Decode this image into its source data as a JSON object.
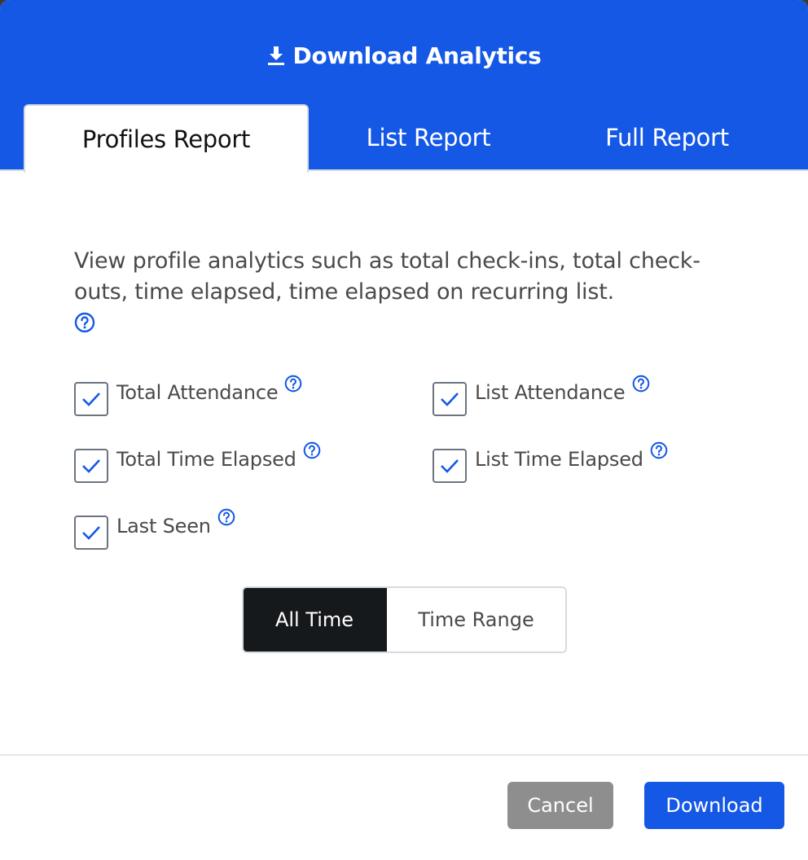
{
  "header": {
    "title": "Download Analytics",
    "title_icon": "download-icon",
    "bg_color": "#1558e6"
  },
  "tabs": [
    {
      "label": "Profiles Report",
      "active": true
    },
    {
      "label": "List Report",
      "active": false
    },
    {
      "label": "Full Report",
      "active": false
    }
  ],
  "description": "View profile analytics such as total check-ins, total check-outs, time elapsed, time elapsed on recurring list.",
  "options": [
    {
      "label": "Total Attendance",
      "checked": true
    },
    {
      "label": "List Attendance",
      "checked": true
    },
    {
      "label": "Total Time Elapsed",
      "checked": true
    },
    {
      "label": "List Time Elapsed",
      "checked": true
    },
    {
      "label": "Last Seen",
      "checked": true
    }
  ],
  "time_toggle": {
    "options": [
      "All Time",
      "Time Range"
    ],
    "selected": "All Time"
  },
  "footer": {
    "cancel_label": "Cancel",
    "download_label": "Download"
  },
  "colors": {
    "accent": "#1558e6",
    "cancel": "#8e8e8e",
    "toggle_active": "#16191c"
  }
}
